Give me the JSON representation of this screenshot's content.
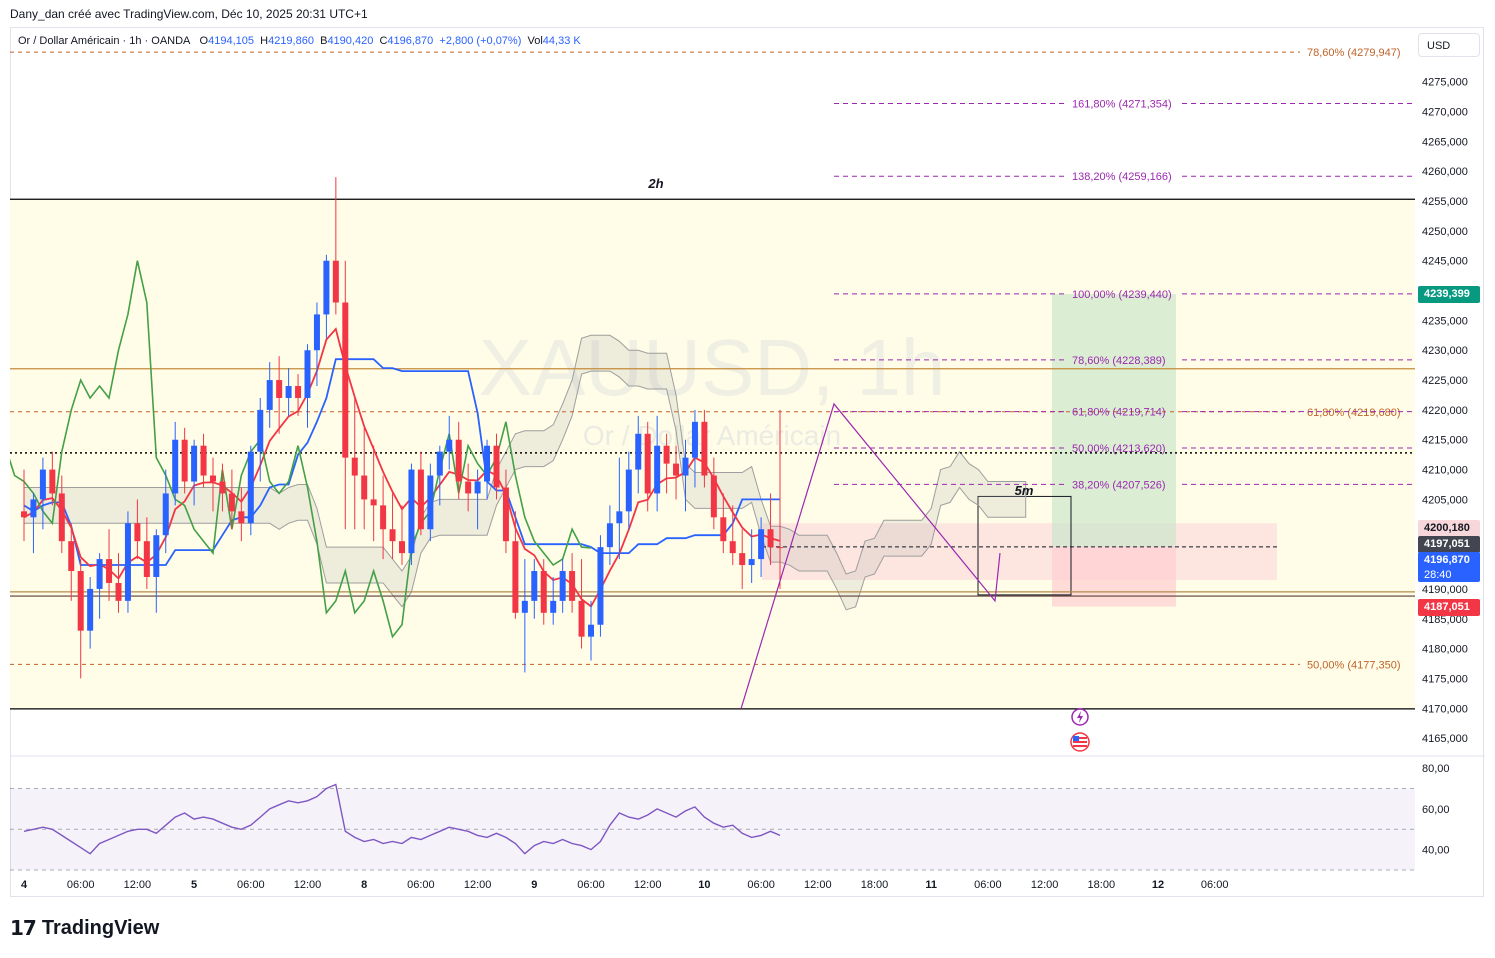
{
  "caption": "Dany_dan créé avec TradingView.com, Déc 10, 2025 20:31 UTC+1",
  "legend": {
    "symbol": "Or / Dollar Américain · 1h · OANDA",
    "o_label": "O",
    "o_value": "4194,105",
    "h_label": "H",
    "h_value": "4219,860",
    "b_label": "B",
    "b_value": "4190,420",
    "c_label": "C",
    "c_value": "4196,870",
    "change": "+2,800 (+0,07%)",
    "vol_label": "Vol",
    "vol_value": "44,33 K"
  },
  "currency_button": "USD",
  "watermark": {
    "symbol": "XAUUSD, 1h",
    "name": "Or / Dollar Américain"
  },
  "annotations": {
    "tf_2h": "2h",
    "tf_5m": "5m"
  },
  "price_tags": [
    {
      "key": "target",
      "label": "4239,399",
      "bg": "#089981",
      "fg": "#ffffff",
      "price": 4239.399
    },
    {
      "key": "level",
      "label": "4200,180",
      "bg": "#f8d7da",
      "fg": "#131722",
      "price": 4200.18
    },
    {
      "key": "ask",
      "label": "4197,051",
      "bg": "#434651",
      "fg": "#ffffff",
      "price": 4197.051
    },
    {
      "key": "last",
      "label": "4196,870",
      "sub": "28:40",
      "bg": "#2962ff",
      "fg": "#ffffff",
      "price": 4196.87
    },
    {
      "key": "stop",
      "label": "4187,051",
      "bg": "#f23645",
      "fg": "#ffffff",
      "price": 4187.051
    }
  ],
  "logo": {
    "mark": "17",
    "name": "TradingView"
  },
  "chart_data": {
    "type": "candlestick",
    "symbol": "XAUUSD",
    "interval": "1h",
    "price_axis": {
      "ylim": [
        4162,
        4284
      ],
      "ticks": [
        "4275,000",
        "4270,000",
        "4265,000",
        "4260,000",
        "4255,000",
        "4250,000",
        "4245,000",
        "4240,000",
        "4235,000",
        "4230,000",
        "4225,000",
        "4220,000",
        "4215,000",
        "4210,000",
        "4205,000",
        "4200,000",
        "4195,000",
        "4190,000",
        "4185,000",
        "4180,000",
        "4175,000",
        "4170,000",
        "4165,000"
      ],
      "tick_values": [
        4275,
        4270,
        4265,
        4260,
        4255,
        4250,
        4245,
        4240,
        4235,
        4230,
        4225,
        4220,
        4215,
        4210,
        4205,
        4200,
        4195,
        4190,
        4185,
        4180,
        4175,
        4170,
        4165
      ]
    },
    "time_axis": {
      "ticks": [
        "4",
        "06:00",
        "12:00",
        "5",
        "06:00",
        "12:00",
        "8",
        "06:00",
        "12:00",
        "9",
        "06:00",
        "12:00",
        "10",
        "06:00",
        "12:00",
        "18:00",
        "11",
        "06:00",
        "12:00",
        "18:00",
        "12",
        "06:00"
      ],
      "bold": [
        true,
        false,
        false,
        true,
        false,
        false,
        true,
        false,
        false,
        true,
        false,
        false,
        true,
        false,
        false,
        false,
        true,
        false,
        false,
        false,
        true,
        false
      ],
      "bar_index": [
        0,
        6,
        12,
        18,
        24,
        30,
        36,
        42,
        48,
        54,
        60,
        66,
        72,
        78,
        84,
        90,
        96,
        102,
        108,
        114,
        120,
        126
      ]
    },
    "candles": [
      [
        4203,
        4210,
        4198,
        4202
      ],
      [
        4202,
        4206,
        4196,
        4205
      ],
      [
        4205,
        4212,
        4200,
        4210
      ],
      [
        4210,
        4213,
        4204,
        4206
      ],
      [
        4206,
        4209,
        4196,
        4198
      ],
      [
        4198,
        4201,
        4188,
        4193
      ],
      [
        4193,
        4195,
        4175,
        4183
      ],
      [
        4183,
        4192,
        4180,
        4190
      ],
      [
        4190,
        4196,
        4185,
        4195
      ],
      [
        4195,
        4200,
        4188,
        4191
      ],
      [
        4191,
        4196,
        4186,
        4188
      ],
      [
        4188,
        4203,
        4186,
        4201
      ],
      [
        4201,
        4205,
        4195,
        4198
      ],
      [
        4198,
        4202,
        4190,
        4192
      ],
      [
        4192,
        4200,
        4186,
        4199
      ],
      [
        4199,
        4210,
        4196,
        4206
      ],
      [
        4206,
        4218,
        4204,
        4215
      ],
      [
        4215,
        4217,
        4206,
        4208
      ],
      [
        4208,
        4215,
        4204,
        4214
      ],
      [
        4214,
        4216,
        4207,
        4209
      ],
      [
        4209,
        4212,
        4203,
        4208
      ],
      [
        4208,
        4211,
        4203,
        4206
      ],
      [
        4206,
        4210,
        4200,
        4203
      ],
      [
        4203,
        4207,
        4198,
        4201
      ],
      [
        4201,
        4214,
        4199,
        4213
      ],
      [
        4213,
        4222,
        4208,
        4220
      ],
      [
        4220,
        4228,
        4217,
        4225
      ],
      [
        4225,
        4229,
        4216,
        4222
      ],
      [
        4222,
        4227,
        4219,
        4224
      ],
      [
        4224,
        4226,
        4219,
        4222
      ],
      [
        4222,
        4231,
        4217,
        4230
      ],
      [
        4230,
        4238,
        4224,
        4236
      ],
      [
        4236,
        4246,
        4232,
        4245
      ],
      [
        4245,
        4259,
        4236,
        4238
      ],
      [
        4238,
        4245,
        4200,
        4212
      ],
      [
        4212,
        4222,
        4200,
        4209
      ],
      [
        4209,
        4217,
        4200,
        4205
      ],
      [
        4205,
        4214,
        4198,
        4204
      ],
      [
        4204,
        4209,
        4195,
        4200
      ],
      [
        4200,
        4206,
        4195,
        4198
      ],
      [
        4198,
        4204,
        4194,
        4196
      ],
      [
        4196,
        4211,
        4194,
        4210
      ],
      [
        4210,
        4213,
        4199,
        4200
      ],
      [
        4200,
        4211,
        4198,
        4209
      ],
      [
        4209,
        4214,
        4204,
        4213
      ],
      [
        4213,
        4219,
        4210,
        4215
      ],
      [
        4215,
        4218,
        4205,
        4208
      ],
      [
        4208,
        4211,
        4203,
        4206
      ],
      [
        4206,
        4210,
        4200,
        4208
      ],
      [
        4208,
        4215,
        4205,
        4214
      ],
      [
        4214,
        4216,
        4205,
        4207
      ],
      [
        4207,
        4210,
        4196,
        4198
      ],
      [
        4198,
        4203,
        4185,
        4186
      ],
      [
        4186,
        4195,
        4176,
        4188
      ],
      [
        4188,
        4195,
        4185,
        4193
      ],
      [
        4193,
        4195,
        4184,
        4186
      ],
      [
        4186,
        4192,
        4184,
        4188
      ],
      [
        4188,
        4195,
        4186,
        4193
      ],
      [
        4193,
        4196,
        4186,
        4188
      ],
      [
        4188,
        4195,
        4180,
        4182
      ],
      [
        4182,
        4188,
        4178,
        4184
      ],
      [
        4184,
        4199,
        4182,
        4197
      ],
      [
        4197,
        4204,
        4194,
        4201
      ],
      [
        4201,
        4212,
        4195,
        4203
      ],
      [
        4203,
        4213,
        4200,
        4210
      ],
      [
        4210,
        4219,
        4206,
        4216
      ],
      [
        4216,
        4218,
        4203,
        4206
      ],
      [
        4206,
        4219,
        4203,
        4214
      ],
      [
        4214,
        4216,
        4206,
        4211
      ],
      [
        4211,
        4214,
        4205,
        4209
      ],
      [
        4209,
        4215,
        4203,
        4212
      ],
      [
        4212,
        4220,
        4207,
        4218
      ],
      [
        4218,
        4220,
        4207,
        4209
      ],
      [
        4209,
        4212,
        4200,
        4202
      ],
      [
        4202,
        4206,
        4196,
        4198
      ],
      [
        4198,
        4204,
        4194,
        4196
      ],
      [
        4196,
        4200,
        4190,
        4194
      ],
      [
        4194,
        4200,
        4191,
        4195
      ],
      [
        4195,
        4202,
        4192,
        4200
      ],
      [
        4200,
        4206,
        4194,
        4197
      ],
      [
        4197,
        4220,
        4190,
        4196.87
      ]
    ],
    "series": [
      {
        "name": "",
        "color": "#f23645",
        "kind": "line"
      },
      {
        "name": "",
        "color": "#2962ff",
        "kind": "line"
      },
      {
        "name": "",
        "color": "#43a047",
        "kind": "line"
      }
    ],
    "horizontal_levels": [
      {
        "price": 4255.3,
        "color": "#000000",
        "style": "solid"
      },
      {
        "price": 4226.9,
        "color": "#c58b3a",
        "style": "solid"
      },
      {
        "price": 4212.8,
        "color": "#000000",
        "style": "dotted"
      },
      {
        "price": 4189.5,
        "color": "#b58a4a",
        "style": "solid"
      },
      {
        "price": 4188.8,
        "color": "#5d4037",
        "style": "solid"
      },
      {
        "price": 4169.9,
        "color": "#000000",
        "style": "solid"
      }
    ],
    "fib_right": [
      {
        "label": "78,60% (4279,947)",
        "price": 4279.947
      },
      {
        "label": "61,80% (4219,680)",
        "price": 4219.68
      },
      {
        "label": "50,00% (4177,350)",
        "price": 4177.35
      }
    ],
    "fib_mid": [
      {
        "label": "161,80% (4271,354)",
        "price": 4271.354
      },
      {
        "label": "138,20% (4259,166)",
        "price": 4259.166
      },
      {
        "label": "100,00% (4239,440)",
        "price": 4239.44
      },
      {
        "label": "78,60% (4228,389)",
        "price": 4228.389
      },
      {
        "label": "61,80% (4219,714)",
        "price": 4219.714
      },
      {
        "label": "50,00% (4213,620)",
        "price": 4213.62
      },
      {
        "label": "38,20% (4207,526)",
        "price": 4207.526
      }
    ],
    "position": {
      "entry": 4197.051,
      "target": 4239.399,
      "stop": 4187.051
    },
    "rsi": {
      "ylim": [
        30,
        85
      ],
      "ticks": [
        "80,00",
        "60,00",
        "40,00"
      ],
      "tick_values": [
        80,
        60,
        40
      ],
      "band": [
        30,
        70
      ],
      "mid": 50,
      "values": [
        49,
        50,
        51,
        50,
        47,
        44,
        41,
        38,
        43,
        45,
        47,
        49,
        50,
        50,
        48,
        52,
        56,
        58,
        55,
        56,
        55,
        53,
        51,
        50,
        52,
        56,
        60,
        62,
        64,
        63,
        64,
        66,
        70,
        72,
        49,
        46,
        44,
        45,
        43,
        44,
        43,
        46,
        45,
        47,
        49,
        51,
        50,
        49,
        47,
        46,
        48,
        46,
        43,
        38,
        42,
        44,
        43,
        45,
        43,
        42,
        40,
        44,
        52,
        58,
        56,
        55,
        57,
        60,
        58,
        56,
        59,
        61,
        56,
        53,
        51,
        52,
        48,
        46,
        47,
        49,
        47
      ]
    }
  }
}
